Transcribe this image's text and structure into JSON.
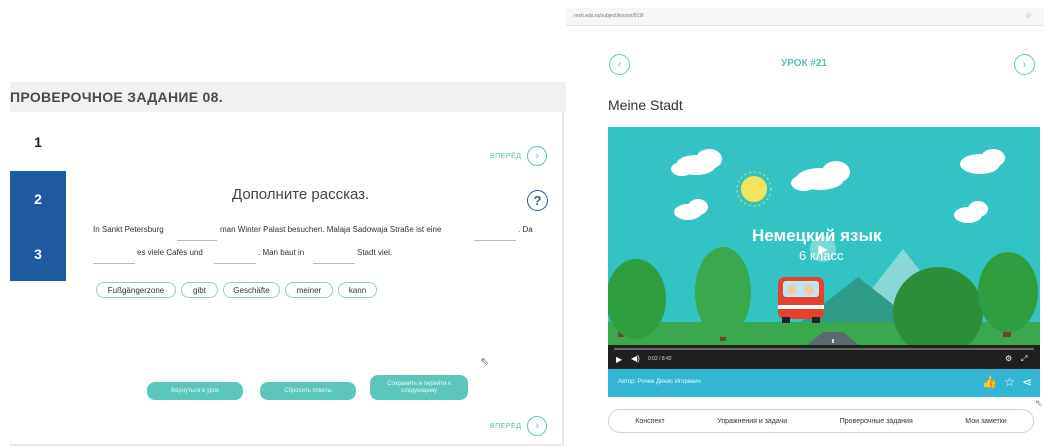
{
  "quiz": {
    "title": "ПРОВЕРОЧНОЕ ЗАДАНИЕ 08.",
    "steps": [
      "1",
      "2",
      "3"
    ],
    "next_label": "ВПЕРЁД",
    "task_title": "Дополните рассказ.",
    "help_symbol": "?",
    "text_parts": [
      "In Sankt Petersburg",
      "man Winter Palast besuchen. Malaja Sadowaja Straße ist eine",
      ". Da",
      "es viele Cafés und",
      ". Man baut in",
      "Stadt viel."
    ],
    "word_chips": [
      "Fußgängerzone",
      "gibt",
      "Geschäfte",
      "meiner",
      "kann"
    ],
    "buttons": {
      "back_to_lesson": "Вернуться в урок",
      "reset": "Сбросить ответы",
      "save_next": "Сохранить и перейти к следующему"
    }
  },
  "lesson": {
    "url": "resh.edu.ru/subject/lesson/919/",
    "number": "УРОК #21",
    "title": "Meine Stadt",
    "video": {
      "title": "Немецкий язык",
      "subtitle": "6 класс",
      "time": "0:02 / 8:42",
      "progress": 0.02
    },
    "author": "Автор: Рочев Денис Игоревич",
    "tabs": [
      "Конспект",
      "Упражнения и задачи",
      "Проверочные задания",
      "Мои заметки"
    ]
  },
  "colors": {
    "accent": "#5cc8bd",
    "step_active": "#1d5aa0",
    "video_bg": "#33c3c2",
    "author_bar": "#33b6d6"
  }
}
